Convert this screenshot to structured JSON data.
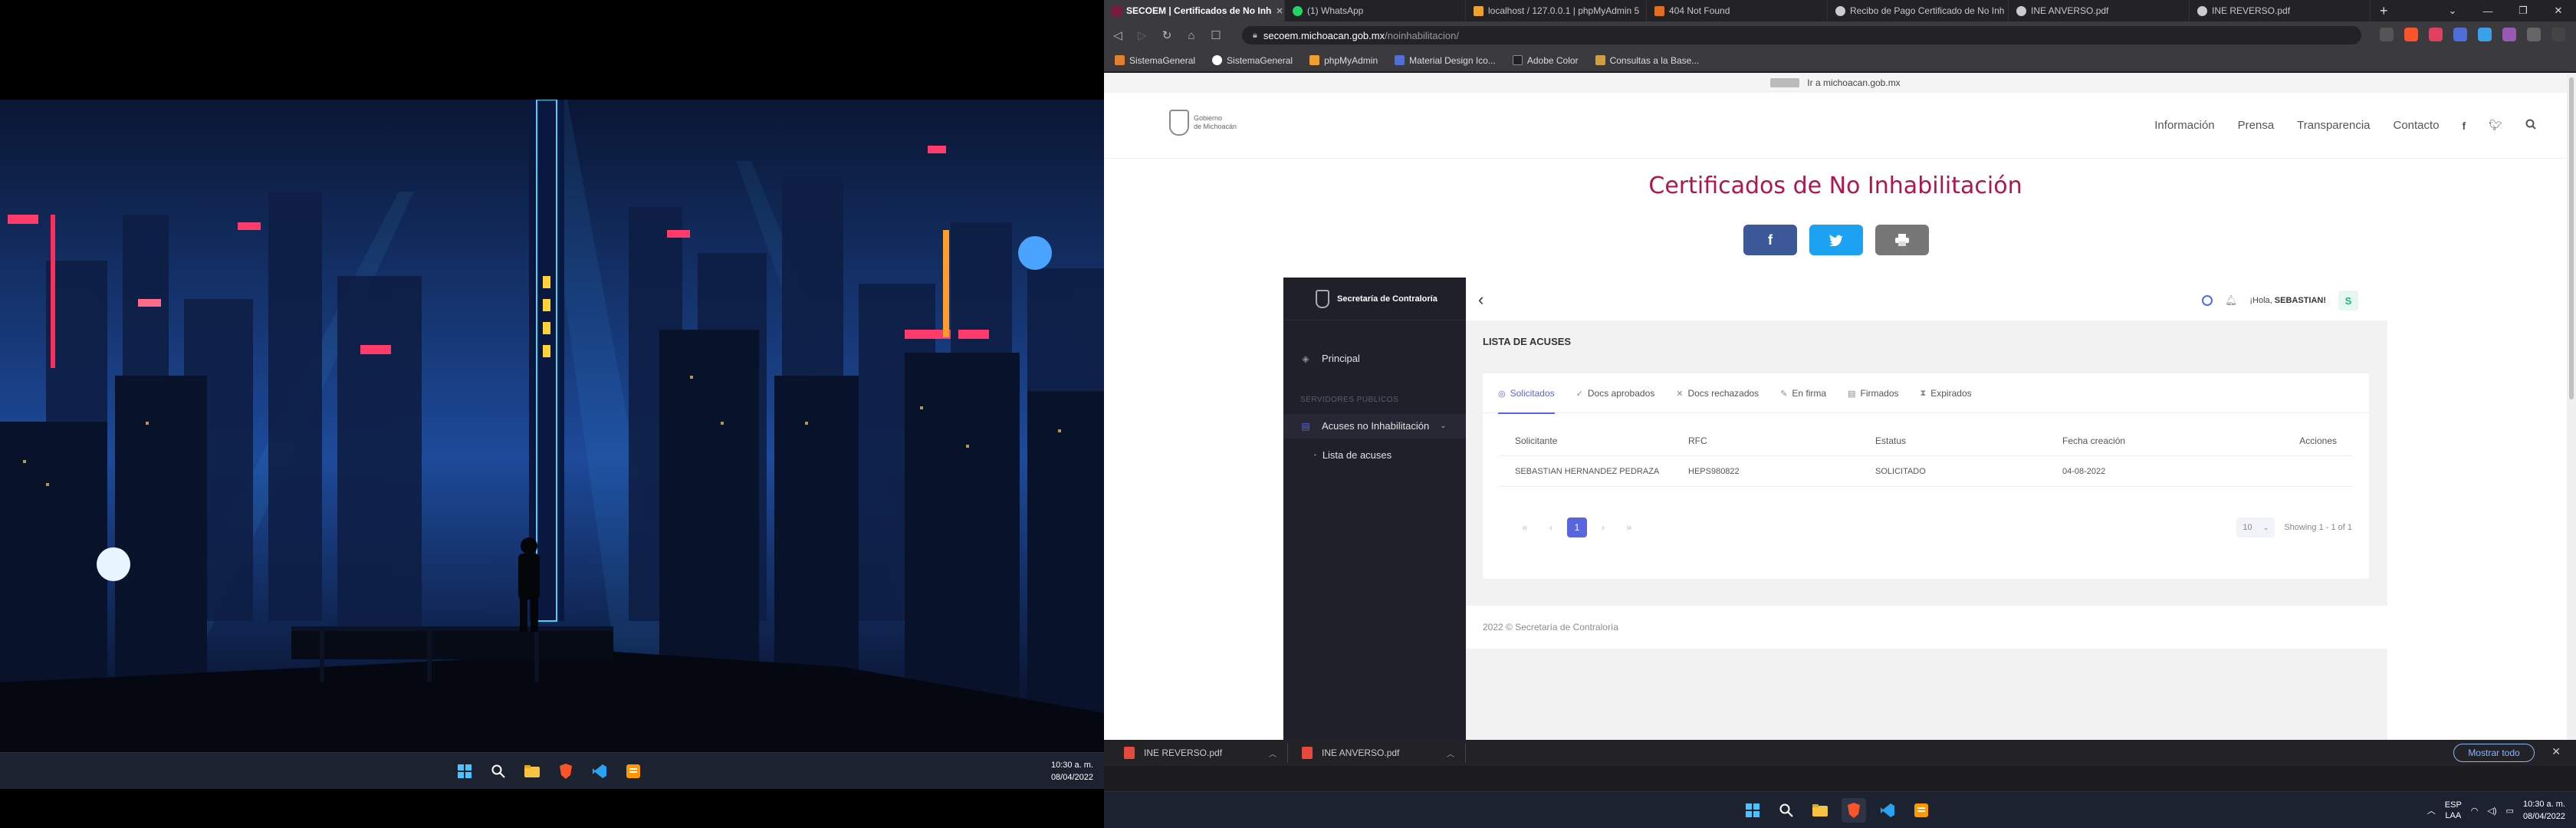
{
  "left_taskbar": {
    "time": "10:30 a. m.",
    "date": "08/04/2022"
  },
  "browser": {
    "tabs": [
      {
        "label": "SECOEM | Certificados de No Inh",
        "active": true,
        "favicon_color": "#7a1b3d"
      },
      {
        "label": "(1) WhatsApp",
        "active": false,
        "favicon_color": "#25d366"
      },
      {
        "label": "localhost / 127.0.0.1 | phpMyAdmin 5",
        "active": false,
        "favicon_color": "#f0a030"
      },
      {
        "label": "404 Not Found",
        "active": false,
        "favicon_color": "#e07020"
      },
      {
        "label": "Recibo de Pago Certificado de No Inh",
        "active": false,
        "favicon_color": "#cccccc"
      },
      {
        "label": "INE ANVERSO.pdf",
        "active": false,
        "favicon_color": "#cccccc"
      },
      {
        "label": "INE REVERSO.pdf",
        "active": false,
        "favicon_color": "#cccccc"
      }
    ],
    "url": {
      "host": "secoem.michoacan.gob.mx",
      "path": "/noinhabilitacion/"
    },
    "bookmarks": [
      {
        "label": "SistemaGeneral",
        "favicon_color": "#e08030"
      },
      {
        "label": "SistemaGeneral",
        "favicon_color": "#ffffff"
      },
      {
        "label": "phpMyAdmin",
        "favicon_color": "#f0a030"
      },
      {
        "label": "Material Design Ico...",
        "favicon_color": "#4f6ed8"
      },
      {
        "label": "Adobe Color",
        "favicon_color": "#222222"
      },
      {
        "label": "Consultas a la Base...",
        "favicon_color": "#d0a040"
      }
    ]
  },
  "site": {
    "gov_link": "Ir a michoacan.gob.mx",
    "logo_line1": "Gobierno",
    "logo_line2": "de Michoacán",
    "menu": [
      "Información",
      "Prensa",
      "Transparencia",
      "Contacto"
    ],
    "title": "Certificados de No Inhabilitación",
    "share": {
      "facebook_color": "#3b5998",
      "twitter_color": "#1da1f2",
      "print_color": "#777777"
    }
  },
  "app": {
    "brand": "Secretaría de Contraloría",
    "sidebar": {
      "principal": "Principal",
      "section": "SERVIDORES PUBLICOS",
      "acuses": "Acuses no Inhabilitación",
      "lista": "Lista de acuses"
    },
    "topbar": {
      "greeting": "¡Hola,",
      "user": "SEBASTIAN!",
      "avatar_letter": "S"
    },
    "section_title": "LISTA DE ACUSES",
    "tabs": [
      "Solicitados",
      "Docs aprobados",
      "Docs rechazados",
      "En firma",
      "Firmados",
      "Expirados"
    ],
    "table": {
      "headers": [
        "Solicitante",
        "RFC",
        "Estatus",
        "Fecha creación",
        "Acciones"
      ],
      "rows": [
        [
          "SEBASTIAN HERNANDEZ PEDRAZA",
          "HEPS980822",
          "SOLICITADO",
          "04-08-2022",
          ""
        ]
      ]
    },
    "pager": {
      "current": "1",
      "page_size": "10",
      "info": "Showing 1 - 1 of 1"
    },
    "footer": "2022 © Secretaría de Contraloría",
    "accent": "#5867dd"
  },
  "downloads": {
    "items": [
      "INE REVERSO.pdf",
      "INE ANVERSO.pdf"
    ],
    "show_all": "Mostrar todo"
  },
  "right_taskbar": {
    "lang_1": "ESP",
    "lang_2": "LAA",
    "time": "10:30 a. m.",
    "date": "08/04/2022"
  }
}
